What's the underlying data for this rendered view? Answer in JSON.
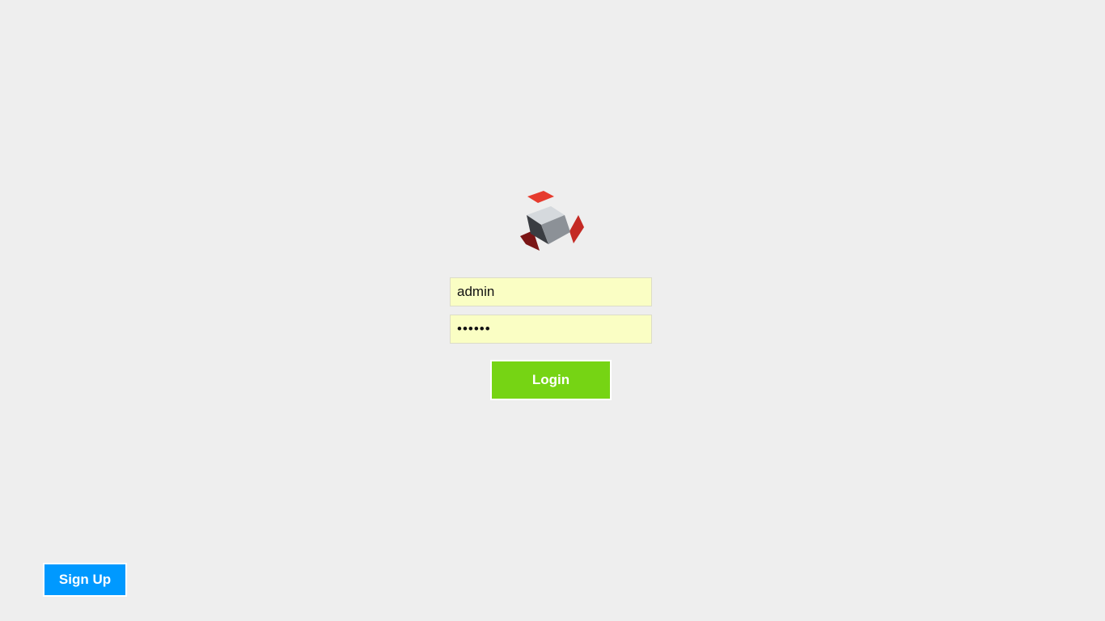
{
  "logo": {
    "icon": "cube-logo-icon",
    "colors": {
      "accent_red": "#e63b2e",
      "accent_dark_red": "#7a1515",
      "cube_top": "#d5d9dd",
      "cube_left": "#3a3d42",
      "cube_right": "#8c9197"
    }
  },
  "login_form": {
    "username_value": "admin",
    "password_value": "••••••",
    "login_label": "Login"
  },
  "signup": {
    "label": "Sign Up"
  },
  "colors": {
    "background": "#eeeeee",
    "input_bg": "#fafec4",
    "login_button": "#76d414",
    "signup_button": "#0099ff"
  }
}
